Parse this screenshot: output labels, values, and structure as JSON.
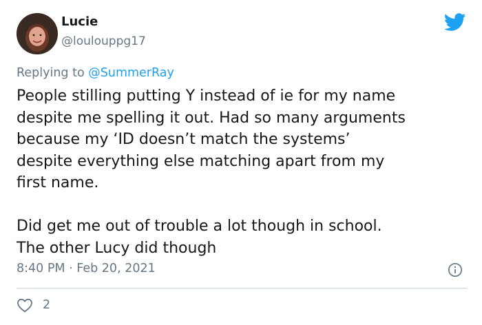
{
  "author": {
    "display_name": "Lucie",
    "handle": "@loulouppg17"
  },
  "reply": {
    "prefix": "Replying to",
    "mention": "@SummerRay"
  },
  "tweet": {
    "paragraph_1": "People stilling putting Y instead of ie for my name\ndespite me spelling it out. Had so many arguments\nbecause my ‘ID doesn’t match the systems’\ndespite everything else matching apart from my\nfirst name.",
    "paragraph_2": "Did get me out of trouble a lot though in school.\nThe other Lucy did though"
  },
  "meta": {
    "time": "8:40 PM",
    "separator": "·",
    "date": "Feb 20, 2021"
  },
  "engagement": {
    "likes": "2"
  },
  "colors": {
    "brand": "#1da1f2",
    "muted": "#657786",
    "text": "#14171a"
  },
  "icons": [
    "twitter-bird-icon",
    "info-icon",
    "heart-icon"
  ]
}
